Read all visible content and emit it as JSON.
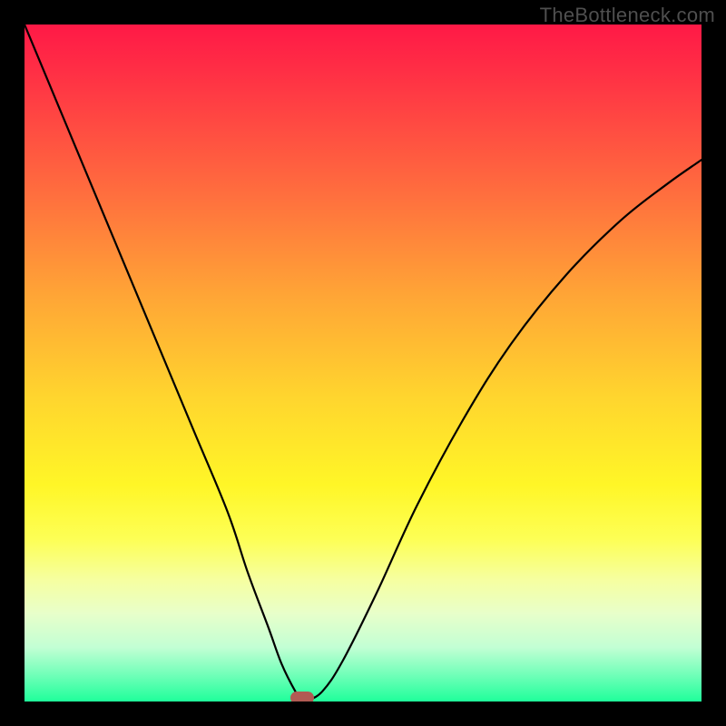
{
  "watermark": "TheBottleneck.com",
  "chart_data": {
    "type": "line",
    "title": "",
    "xlabel": "",
    "ylabel": "",
    "xlim": [
      0,
      100
    ],
    "ylim": [
      0,
      100
    ],
    "series": [
      {
        "name": "curve",
        "x": [
          0,
          5,
          10,
          15,
          20,
          25,
          30,
          33,
          36,
          38,
          40,
          41,
          41.8,
          44,
          47,
          52,
          58,
          65,
          72,
          80,
          88,
          95,
          100
        ],
        "y": [
          100,
          88,
          76,
          64,
          52,
          40,
          28,
          19,
          11,
          5.5,
          1.5,
          0.2,
          0.2,
          1.5,
          6,
          16,
          29,
          42,
          53,
          63,
          71,
          76.5,
          80
        ]
      }
    ],
    "marker": {
      "x": 41,
      "y": 0.5,
      "color": "#b15a53"
    },
    "background_gradient": {
      "stops": [
        {
          "pos": 0.0,
          "color": "#ff1946"
        },
        {
          "pos": 0.25,
          "color": "#ff6e3e"
        },
        {
          "pos": 0.55,
          "color": "#ffd52e"
        },
        {
          "pos": 0.82,
          "color": "#f6ffa0"
        },
        {
          "pos": 1.0,
          "color": "#1fff9b"
        }
      ]
    },
    "curve_color": "#000000"
  }
}
